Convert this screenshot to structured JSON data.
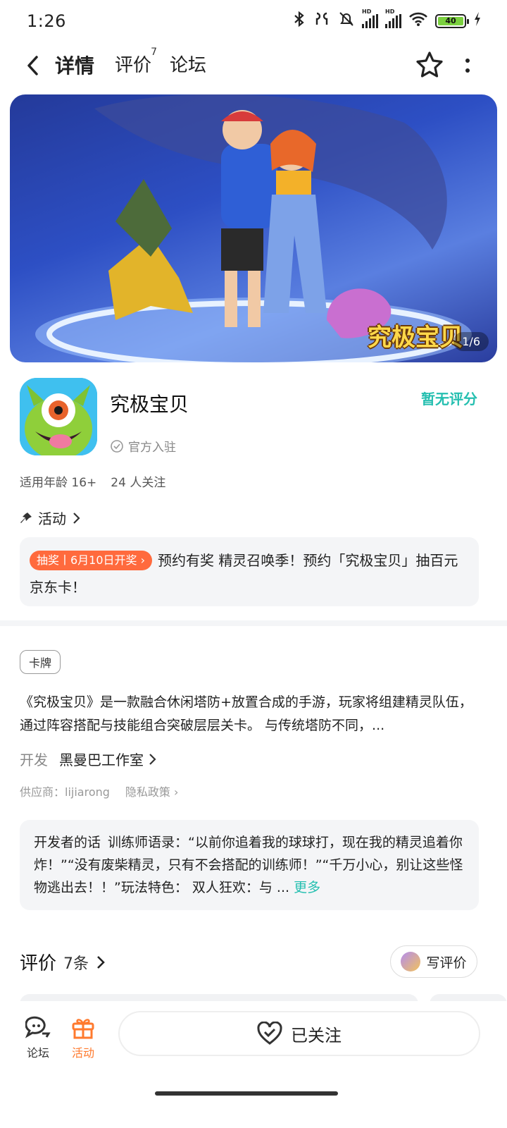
{
  "status_bar": {
    "time": "1:26",
    "battery": "40",
    "icons": [
      "bluetooth-icon",
      "earbuds-icon",
      "bell-muted-icon",
      "signal-hd-icon",
      "signal-hd-icon",
      "wifi-icon",
      "battery-icon",
      "charging-icon"
    ]
  },
  "nav": {
    "tabs": [
      {
        "label": "详情",
        "active": true
      },
      {
        "label": "评价",
        "badge": "7"
      },
      {
        "label": "论坛"
      }
    ]
  },
  "banner": {
    "pager": "1/6",
    "logo_text": "究极宝贝"
  },
  "app": {
    "name": "究极宝贝",
    "verified_label": "官方入驻",
    "rating": "暂无评分",
    "age": "适用年龄 16+",
    "followers": "24 人关注"
  },
  "activity": {
    "heading": "活动",
    "tag": "抽奖丨6月10日开奖",
    "text": "预约有奖 精灵召唤季！预约「究极宝贝」抽百元京东卡！"
  },
  "details": {
    "genre": "卡牌",
    "description": "《究极宝贝》是一款融合休闲塔防+放置合成的手游，玩家将组建精灵队伍，通过阵容搭配与技能组合突破层层关卡。 与传统塔防不同，...",
    "developer_label": "开发",
    "developer": "黑曼巴工作室",
    "supplier": "供应商：lijiarong",
    "privacy": "隐私政策"
  },
  "developer_words": {
    "title": "开发者的话",
    "text": "训练师语录：“以前你追着我的球球打，现在我的精灵追着你炸！”“没有废柴精灵，只有不会搭配的训练师！”“千万小心，别让这些怪物逃出去！！”玩法特色： 双人狂欢：与 ...",
    "more": "更多"
  },
  "reviews": {
    "title": "评价",
    "count": "7条",
    "write": "写评价"
  },
  "bottom_bar": {
    "forum": "论坛",
    "activity": "活动",
    "follow": "已关注"
  },
  "colors": {
    "accent": "#25bfb0",
    "active_tab": "#ff7a2e",
    "lottery_tag": "#ff6a3d"
  }
}
